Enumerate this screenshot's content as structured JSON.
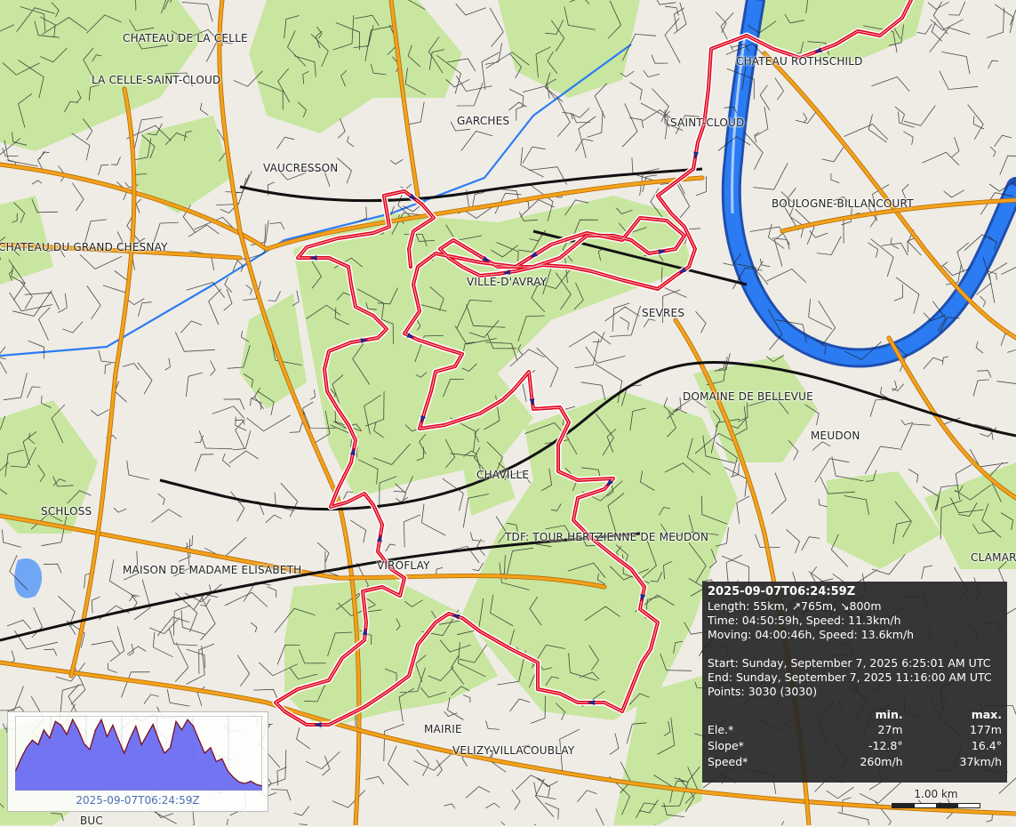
{
  "map": {
    "places": [
      {
        "label": "CHATEAU DE LA CELLE"
      },
      {
        "label": "LA CELLE-SAINT-CLOUD"
      },
      {
        "label": "GARCHES"
      },
      {
        "label": "VAUCRESSON"
      },
      {
        "label": "CHATEAU ROTHSCHILD"
      },
      {
        "label": "SAINT-CLOUD"
      },
      {
        "label": "BOULOGNE-BILLANCOURT"
      },
      {
        "label": "CHATEAU DU GRAND CHESNAY"
      },
      {
        "label": "VILLE-D'AVRAY"
      },
      {
        "label": "SEVRES"
      },
      {
        "label": "DOMAINE DE BELLEVUE"
      },
      {
        "label": "MEUDON"
      },
      {
        "label": "CHAVILLE"
      },
      {
        "label": "SCHLOSS"
      },
      {
        "label": "TDF: TOUR HERTZIENNE DE MEUDON"
      },
      {
        "label": "MAISON DE MADAME ELISABETH"
      },
      {
        "label": "VIROFLAY"
      },
      {
        "label": "CLAMART"
      },
      {
        "label": "MAIRIE"
      },
      {
        "label": "VELIZY-VILLACOUBLAY"
      },
      {
        "label": "BUC"
      }
    ],
    "colors": {
      "track": "#e2001a",
      "track_outline": "#ffffff",
      "forest": "#c8e6a0",
      "water": "#2b7cf2",
      "road_major": "#f4a11c",
      "road_minor": "#222222",
      "profile_fill": "#5a5cf0"
    }
  },
  "info": {
    "title": "2025-09-07T06:24:59Z",
    "length": "Length: 55km, ↗765m, ↘800m",
    "time": "Time: 04:50:59h, Speed: 11.3km/h",
    "moving": "Moving: 04:00:46h, Speed: 13.6km/h",
    "start": "Start: Sunday, September 7, 2025 6:25:01 AM UTC",
    "end": "End: Sunday, September 7, 2025 11:16:00 AM UTC",
    "points": "Points: 3030 (3030)",
    "col_min": "min.",
    "col_max": "max.",
    "rows": [
      {
        "label": "Ele.*",
        "min": "27m",
        "max": "177m"
      },
      {
        "label": "Slope*",
        "min": "-12.8°",
        "max": "16.4°"
      },
      {
        "label": "Speed*",
        "min": "260m/h",
        "max": "37km/h"
      }
    ]
  },
  "profile": {
    "timestamp": "2025-09-07T06:24:59Z",
    "elevation": [
      60,
      88,
      112,
      128,
      118,
      150,
      132,
      168,
      160,
      140,
      172,
      150,
      120,
      108,
      150,
      172,
      135,
      160,
      128,
      100,
      132,
      158,
      118,
      140,
      162,
      128,
      100,
      112,
      168,
      150,
      172,
      158,
      128,
      100,
      112,
      82,
      88,
      62,
      48,
      38,
      35,
      40,
      33,
      30
    ]
  },
  "scale": {
    "label": "1.00 km"
  }
}
